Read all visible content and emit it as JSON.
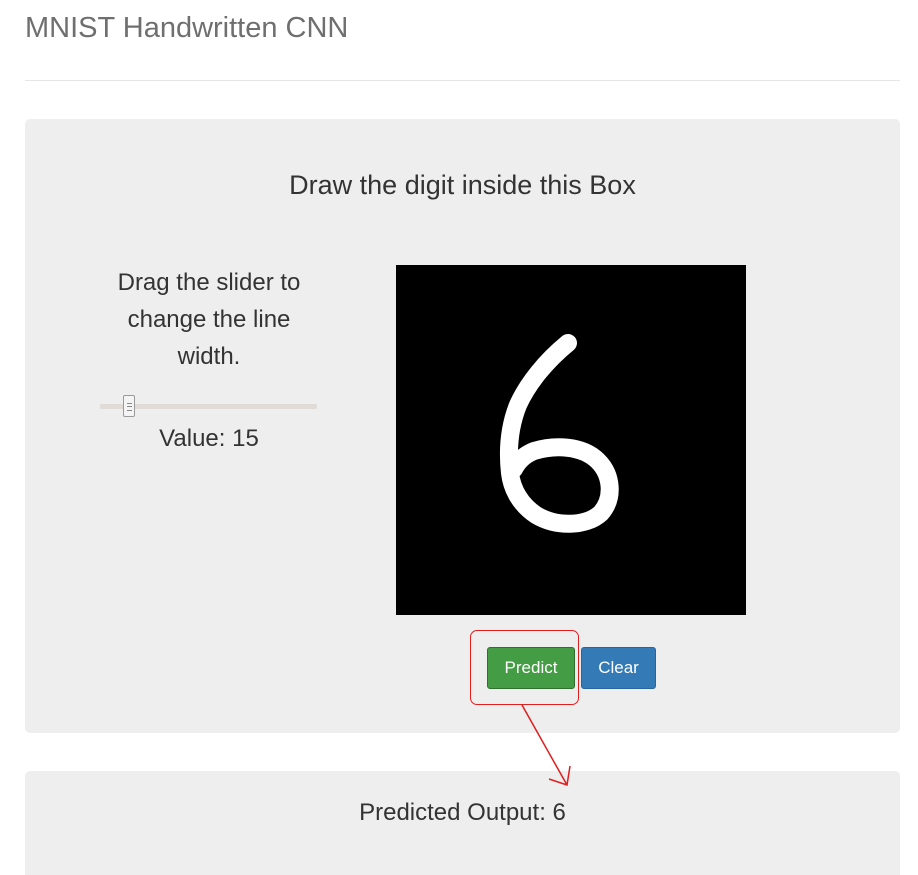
{
  "app": {
    "title": "MNIST Handwritten CNN"
  },
  "draw_panel": {
    "heading": "Draw the digit inside this Box",
    "slider": {
      "help_text": "Drag the slider to change the line width.",
      "value_label": "Value: 15",
      "value": 15
    },
    "canvas": {
      "background": "#000000",
      "stroke_color": "#ffffff",
      "drawn_digit": "6"
    },
    "buttons": {
      "predict_label": "Predict",
      "clear_label": "Clear"
    },
    "annotation": {
      "color": "#e01e1e",
      "highlight": "predict-button"
    }
  },
  "output_panel": {
    "text": "Predicted Output: 6",
    "predicted_digit": "6"
  },
  "colors": {
    "panel_bg": "#eeeeee",
    "predict_green": "#449d44",
    "clear_blue": "#337ab7"
  }
}
